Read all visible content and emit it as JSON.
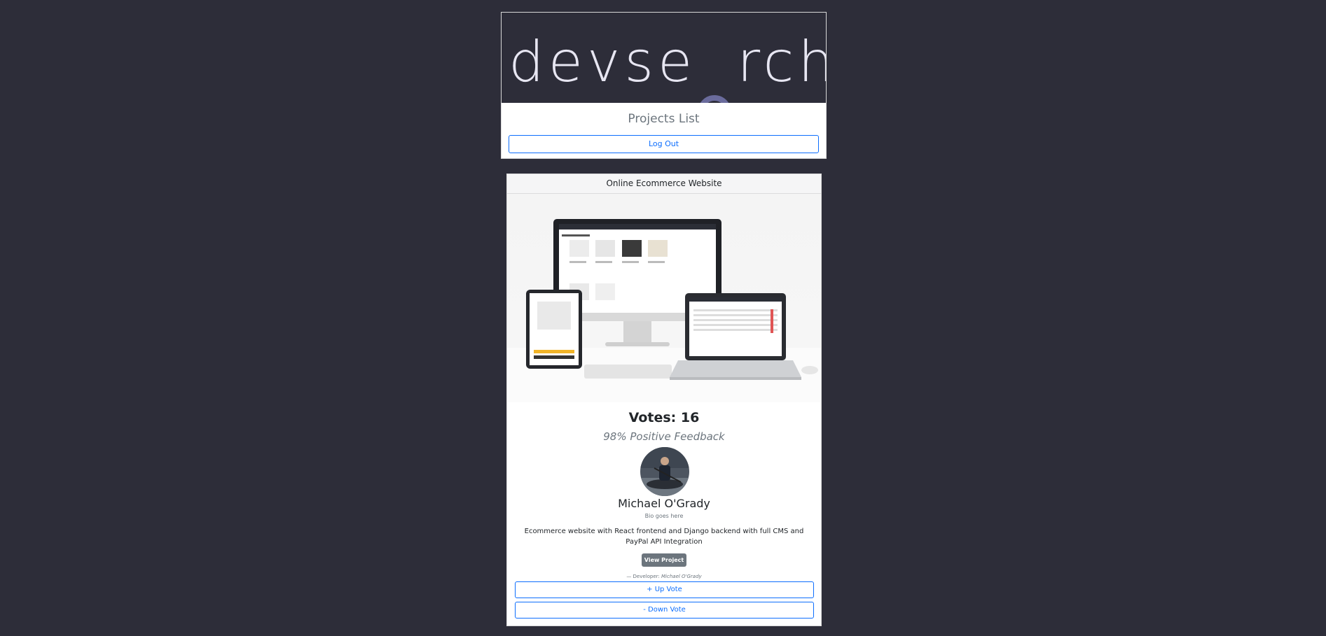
{
  "header": {
    "logo_text_before": "devse",
    "logo_text_after": "rch",
    "page_title": "Projects List",
    "logout_label": "Log Out"
  },
  "project": {
    "title": "Online Ecommerce Website",
    "votes": "Votes: 16",
    "feedback": "98% Positive Feedback",
    "developer_name": "Michael O'Grady",
    "bio": "Bio goes here",
    "description": "Ecommerce website with React frontend and Django backend with full CMS and PayPal API Integration",
    "view_label": "View Project »",
    "credit_prefix": "— Developer:",
    "credit_name": "Michael O'Grady",
    "upvote_label": "+ Up Vote",
    "downvote_label": "- Down Vote"
  },
  "colors": {
    "background": "#2d2d39",
    "accent": "#0d6efd",
    "logo_text": "#e7e6f2",
    "logo_icon": "#6a6b9c"
  },
  "icons": {
    "logo": "magnifier-person-icon"
  }
}
